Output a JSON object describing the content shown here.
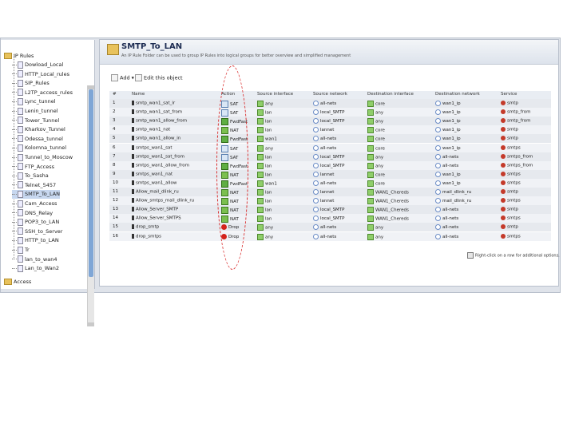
{
  "tree": {
    "root_label": "IP Rules",
    "items": [
      "Dowload_Local",
      "HTTP_Local_rules",
      "SIP_Rules",
      "L2TP_access_rules",
      "Lync_tunnel",
      "Lenin_tunnel",
      "Tower_Tunnel",
      "Kharkov_Tunnel",
      "Odessa_tunnel",
      "Kolomna_tunnel",
      "Tunnel_to_Moscow",
      "FTP_Access",
      "To_Sasha",
      "Telnet_5457",
      "SMTP_To_LAN",
      "Cam_Access",
      "DNS_Relay",
      "POP3_to_LAN",
      "SSH_to_Server",
      "HTTP_to_LAN",
      "Tr",
      "lan_to_wan4",
      "Lan_to_Wan2"
    ],
    "bottom_label": "Access",
    "selected_item": "SMTP_To_LAN"
  },
  "header": {
    "title": "SMTP_To_LAN",
    "subtitle": "An IP Rule Folder can be used to group IP Rules into logical groups for better overview and simplified management"
  },
  "toolbar": {
    "add_label": "Add",
    "add_arrow": "▾",
    "edit_label": "Edit this object"
  },
  "table": {
    "columns": [
      "#",
      "Name",
      "Action",
      "Source interface",
      "Source network",
      "Destination interface",
      "Destination network",
      "Service"
    ],
    "rows": [
      {
        "num": "1",
        "name": "smtp_wan1_sat_lr",
        "action": "SAT",
        "src_if": "any",
        "src_net": "all-nets",
        "dst_if": "core",
        "dst_net": "wan1_ip",
        "svc": "smtp"
      },
      {
        "num": "2",
        "name": "smtp_wan1_sat_from",
        "action": "SAT",
        "src_if": "lan",
        "src_net": "local_SMTP",
        "dst_if": "any",
        "dst_net": "wan1_ip",
        "svc": "smtp_from"
      },
      {
        "num": "3",
        "name": "smtp_wan1_allow_from",
        "action": "FwdFast",
        "src_if": "lan",
        "src_net": "local_SMTP",
        "dst_if": "any",
        "dst_net": "wan1_ip",
        "svc": "smtp_from"
      },
      {
        "num": "4",
        "name": "smtp_wan1_nat",
        "action": "NAT",
        "src_if": "lan",
        "src_net": "lannet",
        "dst_if": "core",
        "dst_net": "wan1_ip",
        "svc": "smtp"
      },
      {
        "num": "5",
        "name": "smtp_wan1_allow_in",
        "action": "FwdFast",
        "src_if": "wan1",
        "src_net": "all-nets",
        "dst_if": "core",
        "dst_net": "wan1_ip",
        "svc": "smtp"
      },
      {
        "num": "6",
        "name": "smtps_wan1_sat",
        "action": "SAT",
        "src_if": "any",
        "src_net": "all-nets",
        "dst_if": "core",
        "dst_net": "wan1_ip",
        "svc": "smtps"
      },
      {
        "num": "7",
        "name": "smtps_wan1_sat_from",
        "action": "SAT",
        "src_if": "lan",
        "src_net": "local_SMTP",
        "dst_if": "any",
        "dst_net": "all-nets",
        "svc": "smtps_from"
      },
      {
        "num": "8",
        "name": "smtps_wan1_allow_from",
        "action": "FwdFast",
        "src_if": "lan",
        "src_net": "local_SMTP",
        "dst_if": "any",
        "dst_net": "all-nets",
        "svc": "smtps_from"
      },
      {
        "num": "9",
        "name": "smtps_wan1_nat",
        "action": "NAT",
        "src_if": "lan",
        "src_net": "lannet",
        "dst_if": "core",
        "dst_net": "wan1_ip",
        "svc": "smtps"
      },
      {
        "num": "10",
        "name": "smtps_wan1_allow",
        "action": "FwdFast",
        "src_if": "wan1",
        "src_net": "all-nets",
        "dst_if": "core",
        "dst_net": "wan1_ip",
        "svc": "smtps"
      },
      {
        "num": "11",
        "name": "Allow_mail_dlink_ru",
        "action": "NAT",
        "src_if": "lan",
        "src_net": "lannet",
        "dst_if": "WAN1_Chereds",
        "dst_net": "mail_dlink_ru",
        "svc": "smtp"
      },
      {
        "num": "12",
        "name": "Allow_smtps_mail_dlink_ru",
        "action": "NAT",
        "src_if": "lan",
        "src_net": "lannet",
        "dst_if": "WAN1_Chereds",
        "dst_net": "mail_dlink_ru",
        "svc": "smtps"
      },
      {
        "num": "13",
        "name": "Allow_Server_SMTP",
        "action": "NAT",
        "src_if": "lan",
        "src_net": "local_SMTP",
        "dst_if": "WAN1_Chereds",
        "dst_net": "all-nets",
        "svc": "smtp"
      },
      {
        "num": "14",
        "name": "Allow_Server_SMTPS",
        "action": "NAT",
        "src_if": "lan",
        "src_net": "local_SMTP",
        "dst_if": "WAN1_Chereds",
        "dst_net": "all-nets",
        "svc": "smtps"
      },
      {
        "num": "15",
        "name": "drop_smtp",
        "action": "Drop",
        "src_if": "any",
        "src_net": "all-nets",
        "dst_if": "any",
        "dst_net": "all-nets",
        "svc": "smtp"
      },
      {
        "num": "16",
        "name": "drop_smtps",
        "action": "Drop",
        "src_if": "any",
        "src_net": "all-nets",
        "dst_if": "any",
        "dst_net": "all-nets",
        "svc": "smtps"
      }
    ]
  },
  "footer": {
    "hint": "Right-click on a row for additional options."
  },
  "colors": {
    "highlight_ellipse": "#d92a2a",
    "title_text": "#1d2c52"
  }
}
